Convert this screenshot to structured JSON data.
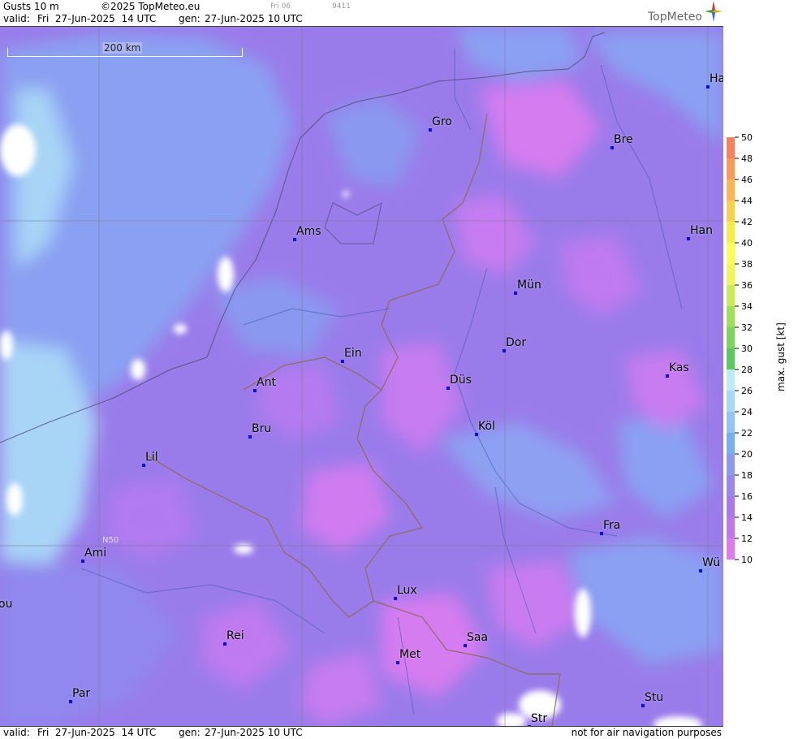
{
  "header": {
    "product": "Gusts 10 m",
    "copyright": "©2025 TopMeteo.eu",
    "run_small": "Fri 06",
    "code_small": "9411",
    "valid_label": "valid:",
    "valid_value": "Fri  27-Jun-2025  14 UTC",
    "gen_label": "gen:",
    "gen_value": "27-Jun-2025 10 UTC",
    "logo_text": "TopMeteo"
  },
  "scale_bar": {
    "label": "200 km"
  },
  "latitude_label": "N50",
  "cities": [
    {
      "name": "Gro"
    },
    {
      "name": "Bre"
    },
    {
      "name": "Ha"
    },
    {
      "name": "Ams"
    },
    {
      "name": "Han"
    },
    {
      "name": "Mün"
    },
    {
      "name": "Dor"
    },
    {
      "name": "Ein"
    },
    {
      "name": "Kas"
    },
    {
      "name": "Düs"
    },
    {
      "name": "Ant"
    },
    {
      "name": "Köl"
    },
    {
      "name": "Bru"
    },
    {
      "name": "Lil"
    },
    {
      "name": "Fra"
    },
    {
      "name": "Ami"
    },
    {
      "name": "Wü"
    },
    {
      "name": "Lux"
    },
    {
      "name": "ou"
    },
    {
      "name": "Rei"
    },
    {
      "name": "Saa"
    },
    {
      "name": "Met"
    },
    {
      "name": "Par"
    },
    {
      "name": "Stu"
    },
    {
      "name": "Str"
    }
  ],
  "colorbar": {
    "title": "max. gust [kt]",
    "ticks": [
      "50",
      "48",
      "46",
      "44",
      "42",
      "40",
      "38",
      "36",
      "34",
      "32",
      "30",
      "28",
      "26",
      "24",
      "22",
      "20",
      "18",
      "16",
      "14",
      "12",
      "10"
    ],
    "colors": [
      "#f8805a",
      "#fa9a58",
      "#fbb555",
      "#f8d050",
      "#f5ec4e",
      "#fdfb58",
      "#eef65a",
      "#c6ec58",
      "#9fe05a",
      "#7cd45e",
      "#5cc860",
      "#bceaf6",
      "#a8d8f6",
      "#92c4f6",
      "#7aaef4",
      "#8c9af2",
      "#9a86f2",
      "#aa78ee",
      "#c276ee",
      "#df7aee"
    ]
  },
  "footer": {
    "valid_label": "valid:",
    "valid_value": "Fri  27-Jun-2025  14 UTC",
    "gen_label": "gen:",
    "gen_value": "27-Jun-2025 10 UTC",
    "disclaimer": "not for air navigation purposes"
  },
  "colors": {
    "base": "#9a78ea",
    "strong": "#d57cf0",
    "weak": "#88a4f2",
    "calm": "#a8d4f6",
    "border": "#8a6a50",
    "river": "#3a56a8",
    "city_marker": "#1010d0"
  }
}
